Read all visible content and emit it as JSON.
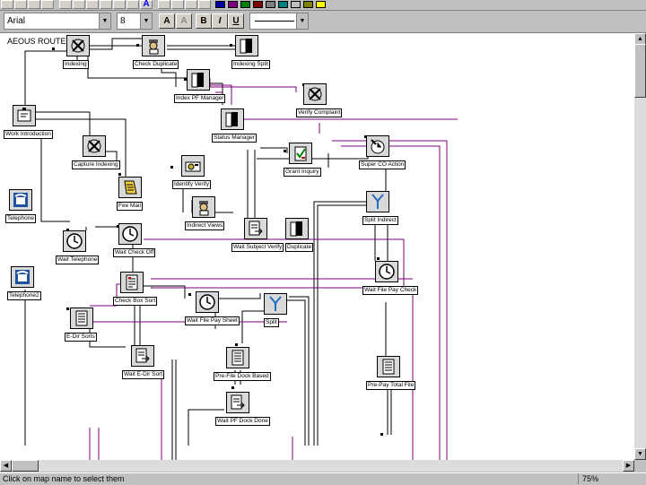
{
  "toolbar": {
    "font_name": "Arial",
    "font_size": "8",
    "bold_label": "B",
    "italic_label": "I",
    "underline_label": "U",
    "font_color_label": "A",
    "colors": [
      "#0000a0",
      "#800080",
      "#008000",
      "#800000",
      "#808080",
      "#008080",
      "#c0c0c0",
      "#808000",
      "#ffff00"
    ]
  },
  "diagram": {
    "title": "AEOUS ROUTE",
    "nodes": [
      {
        "id": "indexing",
        "label": "Indexing",
        "icon": "tools-icon"
      },
      {
        "id": "check-duplicate",
        "label": "Check Duplicate",
        "icon": "inspector-icon"
      },
      {
        "id": "indexing-split",
        "label": "Indexing Split",
        "icon": "book-icon"
      },
      {
        "id": "index-pf-manager",
        "label": "Index PF Manager",
        "icon": "book-icon"
      },
      {
        "id": "verify-complaint",
        "label": "Verify Complaint",
        "icon": "tools-icon"
      },
      {
        "id": "status-manager",
        "label": "Status Manager",
        "icon": "book-icon"
      },
      {
        "id": "work-introduction",
        "label": "Work Introduction",
        "icon": "people-icon"
      },
      {
        "id": "capture-indexing",
        "label": "Capture Indexing",
        "icon": "tools-icon"
      },
      {
        "id": "identify-verify",
        "label": "Identify Verify",
        "icon": "scanner-icon"
      },
      {
        "id": "grant-inquiry",
        "label": "Grant Inquiry",
        "icon": "check-icon"
      },
      {
        "id": "super-co-action",
        "label": "Super CO Action",
        "icon": "tools-clock-icon"
      },
      {
        "id": "fee-mail",
        "label": "Fee Mail",
        "icon": "letter-icon"
      },
      {
        "id": "indirect-views",
        "label": "Indirect Views",
        "icon": "inspector-icon"
      },
      {
        "id": "telephone",
        "label": "Telephone",
        "icon": "telephone-icon"
      },
      {
        "id": "split-indirect",
        "label": "Split Indirect",
        "icon": "split-icon"
      },
      {
        "id": "wait-telephone",
        "label": "Wait Telephone",
        "icon": "clock-icon"
      },
      {
        "id": "wait-check-off",
        "label": "Wait Check Off",
        "icon": "clock-icon"
      },
      {
        "id": "wait-subject-verify",
        "label": "Wait Subject Verify",
        "icon": "document-arrow-icon"
      },
      {
        "id": "duplicate",
        "label": "Duplicate",
        "icon": "book-icon"
      },
      {
        "id": "telephone2",
        "label": "Telephone2",
        "icon": "telephone-icon"
      },
      {
        "id": "check-box-sort",
        "label": "Check Box Sort",
        "icon": "form-icon"
      },
      {
        "id": "wait-file-pay-sheet",
        "label": "Wait File Pay Sheet",
        "icon": "clock-icon"
      },
      {
        "id": "split",
        "label": "Split",
        "icon": "split-icon"
      },
      {
        "id": "wait-file-pay-check",
        "label": "Wait File Pay Check",
        "icon": "clock-icon"
      },
      {
        "id": "e-dir-sorts",
        "label": "E-Dir Sorts",
        "icon": "list-icon"
      },
      {
        "id": "wait-e-dir-sort",
        "label": "Wait E-Dir Sort",
        "icon": "document-arrow-icon"
      },
      {
        "id": "pre-file-dock-based",
        "label": "Pre-File Dock Based",
        "icon": "list-icon"
      },
      {
        "id": "pre-pay-total-file",
        "label": "Pre-Pay Total File",
        "icon": "list-icon"
      },
      {
        "id": "wait-pf-dock-done",
        "label": "Wait PF Dock Done",
        "icon": "document-arrow-icon"
      }
    ]
  },
  "statusbar": {
    "message": "Click on map name to select them",
    "zoom": "75%"
  }
}
